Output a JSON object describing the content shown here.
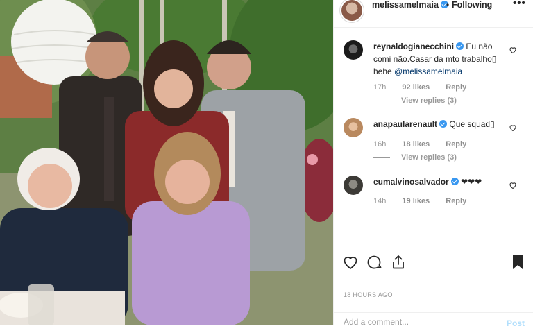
{
  "header": {
    "username": "melissamelmaia",
    "separator": "•",
    "follow_label": "Following",
    "more_label": "•••",
    "avatar_icon": "profile-avatar"
  },
  "comments": [
    {
      "username": "reynaldogianecchini",
      "text": "Eu não comi não.Casar da mto trabalho▯ hehe ",
      "mention": "@melissamelmaia",
      "time": "17h",
      "likes": "92 likes",
      "reply": "Reply",
      "view_replies": "View replies (3)",
      "verified": true
    },
    {
      "username": "anapaularenault",
      "text": "Que squad▯",
      "time": "16h",
      "likes": "18 likes",
      "reply": "Reply",
      "view_replies": "View replies (3)",
      "verified": true
    },
    {
      "username": "eumalvinosalvador",
      "text": "❤❤❤",
      "time": "14h",
      "likes": "19 likes",
      "reply": "Reply",
      "verified": true
    }
  ],
  "actions": {
    "like_icon": "heart-icon",
    "comment_icon": "comment-bubble-icon",
    "share_icon": "share-icon",
    "save_icon": "bookmark-icon"
  },
  "timestamp": "18 HOURS AGO",
  "add_comment": {
    "placeholder": "Add a comment...",
    "post_label": "Post"
  },
  "colors": {
    "verified_blue": "#3897f0",
    "meta_gray": "#999999",
    "post_disabled": "#b2dffc",
    "divider": "#efefef"
  }
}
